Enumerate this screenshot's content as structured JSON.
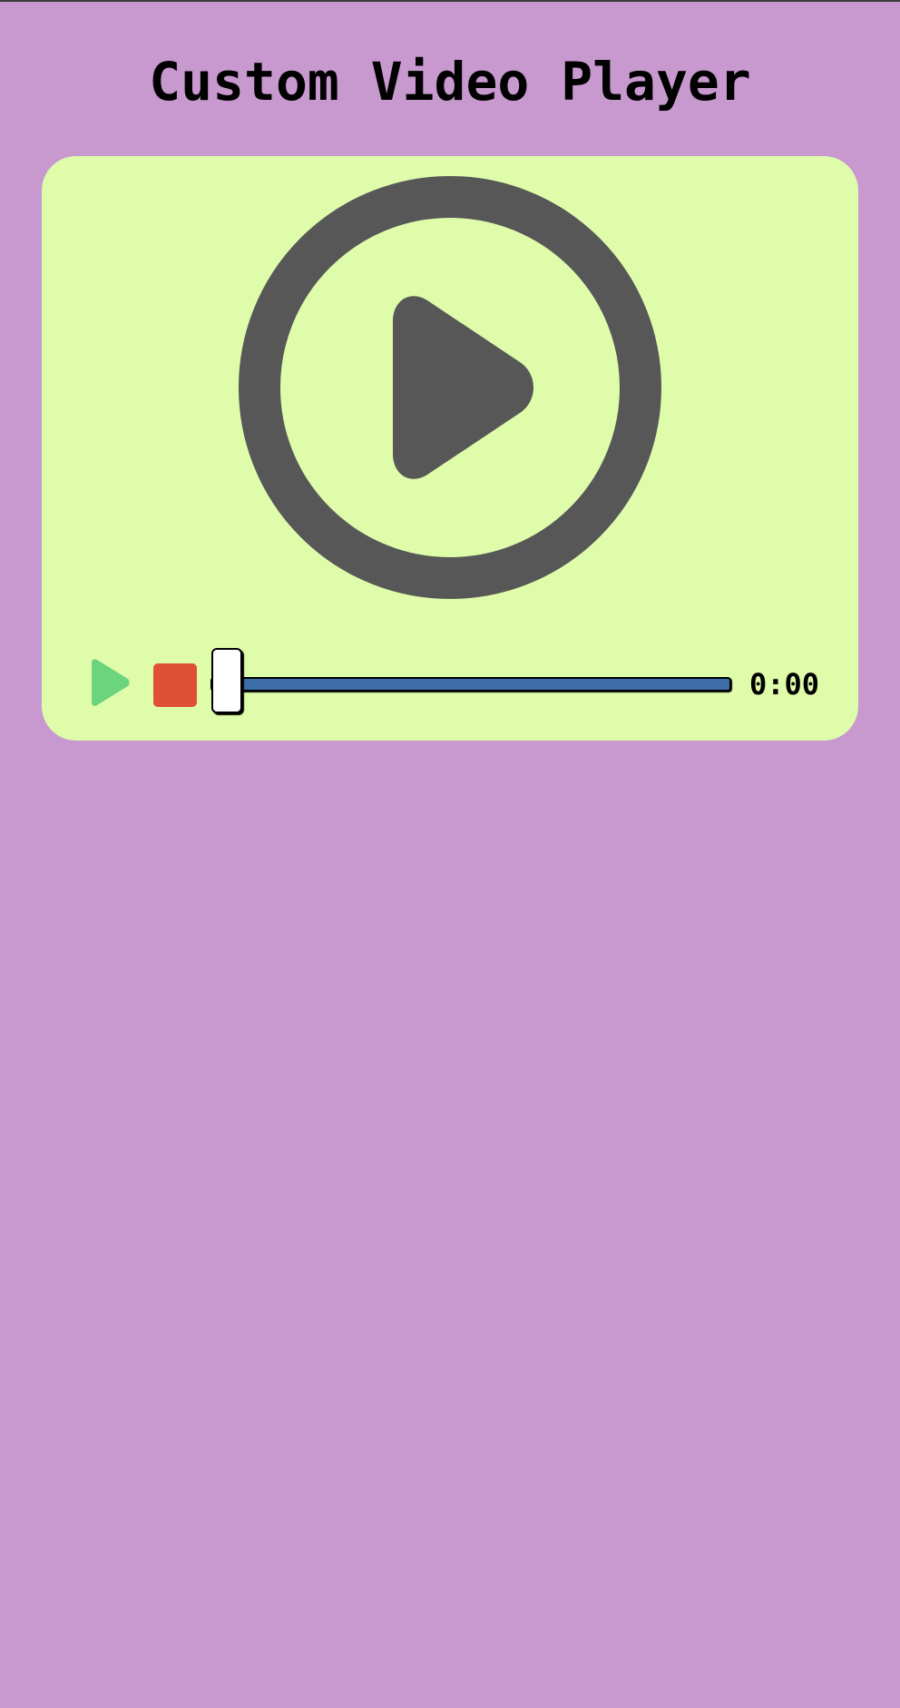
{
  "page": {
    "title": "Custom Video Player"
  },
  "player": {
    "big_play_icon": "circle-play-icon",
    "controls": {
      "play_icon": "play-icon",
      "stop_icon": "stop-icon",
      "progress_fraction": 0,
      "time": "0:00"
    }
  },
  "colors": {
    "background": "#c899cf",
    "player_background": "#dffcab",
    "big_play_icon": "#575757",
    "play_button": "#6dd47e",
    "stop_button": "#e05035",
    "progress_track": "#3d6ea8",
    "progress_thumb": "#ffffff"
  }
}
